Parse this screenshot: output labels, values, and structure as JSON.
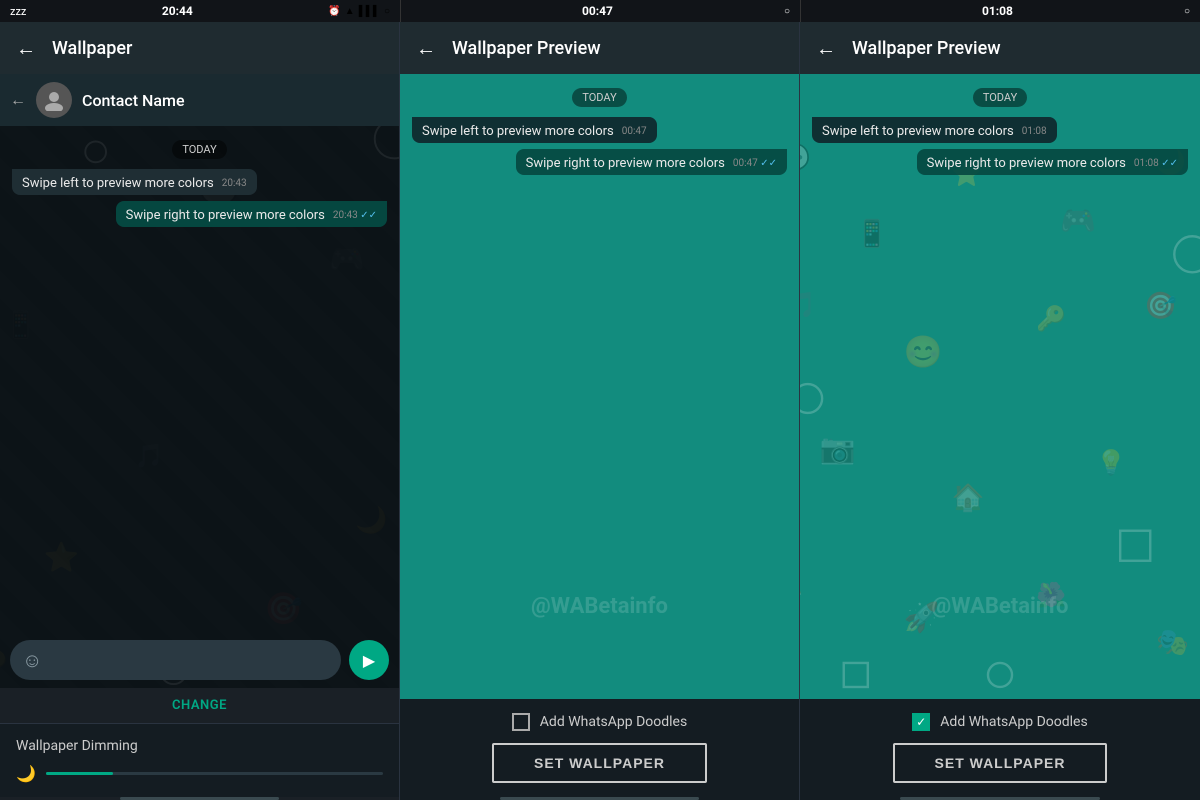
{
  "panel1": {
    "statusbar": {
      "left": "ZZZ",
      "time": "20:44",
      "icons": [
        "alarm",
        "wifi",
        "signal",
        "signal2",
        "circle"
      ]
    },
    "title": "Wallpaper",
    "contact_name": "Contact Name",
    "date_label": "TODAY",
    "messages": [
      {
        "type": "received",
        "text": "Swipe left to preview more colors",
        "time": "20:43"
      },
      {
        "type": "sent",
        "text": "Swipe right to preview more colors",
        "time": "20:43",
        "ticks": "✓✓"
      }
    ],
    "change_label": "CHANGE",
    "dimming_label": "Wallpaper Dimming"
  },
  "panel2": {
    "statusbar": {
      "time": "00:47",
      "right_icon": "circle"
    },
    "title": "Wallpaper Preview",
    "date_label": "TODAY",
    "messages": [
      {
        "type": "received",
        "text": "Swipe left to preview more colors",
        "time": "00:47"
      },
      {
        "type": "sent",
        "text": "Swipe right to preview more colors",
        "time": "00:47",
        "ticks": "✓✓"
      }
    ],
    "add_doodles_label": "Add WhatsApp Doodles",
    "checkbox_checked": false,
    "set_wallpaper_label": "SET WALLPAPER"
  },
  "panel3": {
    "statusbar": {
      "time": "01:08",
      "right_icon": "circle"
    },
    "title": "Wallpaper Preview",
    "date_label": "TODAY",
    "messages": [
      {
        "type": "received",
        "text": "Swipe left to preview more colors",
        "time": "01:08"
      },
      {
        "type": "sent",
        "text": "Swipe right to preview more colors",
        "time": "01:08",
        "ticks": "✓✓"
      }
    ],
    "add_doodles_label": "Add WhatsApp Doodles",
    "checkbox_checked": true,
    "set_wallpaper_label": "SET WALLPAPER"
  },
  "watermark": "@WABetainfo",
  "colors": {
    "teal": "#00a884",
    "dark_bg": "#1a1f2e",
    "chat_bg": "#0c1317",
    "header_bg": "#1f2b30"
  }
}
